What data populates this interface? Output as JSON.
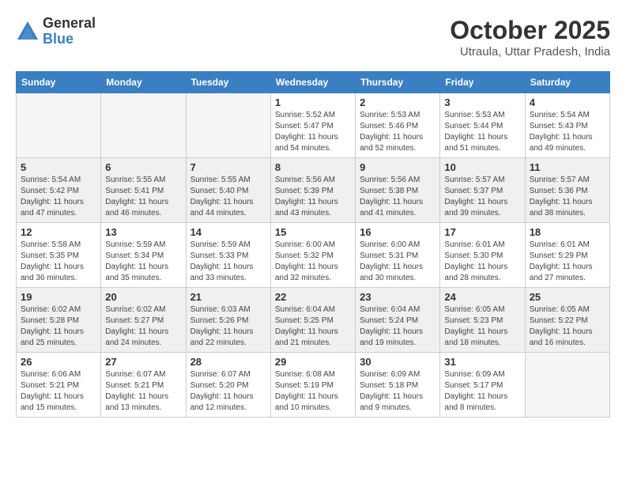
{
  "logo": {
    "general": "General",
    "blue": "Blue"
  },
  "title": {
    "month": "October 2025",
    "location": "Utraula, Uttar Pradesh, India"
  },
  "headers": [
    "Sunday",
    "Monday",
    "Tuesday",
    "Wednesday",
    "Thursday",
    "Friday",
    "Saturday"
  ],
  "weeks": [
    {
      "shaded": false,
      "days": [
        {
          "num": "",
          "sunrise": "",
          "sunset": "",
          "daylight": ""
        },
        {
          "num": "",
          "sunrise": "",
          "sunset": "",
          "daylight": ""
        },
        {
          "num": "",
          "sunrise": "",
          "sunset": "",
          "daylight": ""
        },
        {
          "num": "1",
          "sunrise": "Sunrise: 5:52 AM",
          "sunset": "Sunset: 5:47 PM",
          "daylight": "Daylight: 11 hours and 54 minutes."
        },
        {
          "num": "2",
          "sunrise": "Sunrise: 5:53 AM",
          "sunset": "Sunset: 5:46 PM",
          "daylight": "Daylight: 11 hours and 52 minutes."
        },
        {
          "num": "3",
          "sunrise": "Sunrise: 5:53 AM",
          "sunset": "Sunset: 5:44 PM",
          "daylight": "Daylight: 11 hours and 51 minutes."
        },
        {
          "num": "4",
          "sunrise": "Sunrise: 5:54 AM",
          "sunset": "Sunset: 5:43 PM",
          "daylight": "Daylight: 11 hours and 49 minutes."
        }
      ]
    },
    {
      "shaded": true,
      "days": [
        {
          "num": "5",
          "sunrise": "Sunrise: 5:54 AM",
          "sunset": "Sunset: 5:42 PM",
          "daylight": "Daylight: 11 hours and 47 minutes."
        },
        {
          "num": "6",
          "sunrise": "Sunrise: 5:55 AM",
          "sunset": "Sunset: 5:41 PM",
          "daylight": "Daylight: 11 hours and 46 minutes."
        },
        {
          "num": "7",
          "sunrise": "Sunrise: 5:55 AM",
          "sunset": "Sunset: 5:40 PM",
          "daylight": "Daylight: 11 hours and 44 minutes."
        },
        {
          "num": "8",
          "sunrise": "Sunrise: 5:56 AM",
          "sunset": "Sunset: 5:39 PM",
          "daylight": "Daylight: 11 hours and 43 minutes."
        },
        {
          "num": "9",
          "sunrise": "Sunrise: 5:56 AM",
          "sunset": "Sunset: 5:38 PM",
          "daylight": "Daylight: 11 hours and 41 minutes."
        },
        {
          "num": "10",
          "sunrise": "Sunrise: 5:57 AM",
          "sunset": "Sunset: 5:37 PM",
          "daylight": "Daylight: 11 hours and 39 minutes."
        },
        {
          "num": "11",
          "sunrise": "Sunrise: 5:57 AM",
          "sunset": "Sunset: 5:36 PM",
          "daylight": "Daylight: 11 hours and 38 minutes."
        }
      ]
    },
    {
      "shaded": false,
      "days": [
        {
          "num": "12",
          "sunrise": "Sunrise: 5:58 AM",
          "sunset": "Sunset: 5:35 PM",
          "daylight": "Daylight: 11 hours and 36 minutes."
        },
        {
          "num": "13",
          "sunrise": "Sunrise: 5:59 AM",
          "sunset": "Sunset: 5:34 PM",
          "daylight": "Daylight: 11 hours and 35 minutes."
        },
        {
          "num": "14",
          "sunrise": "Sunrise: 5:59 AM",
          "sunset": "Sunset: 5:33 PM",
          "daylight": "Daylight: 11 hours and 33 minutes."
        },
        {
          "num": "15",
          "sunrise": "Sunrise: 6:00 AM",
          "sunset": "Sunset: 5:32 PM",
          "daylight": "Daylight: 11 hours and 32 minutes."
        },
        {
          "num": "16",
          "sunrise": "Sunrise: 6:00 AM",
          "sunset": "Sunset: 5:31 PM",
          "daylight": "Daylight: 11 hours and 30 minutes."
        },
        {
          "num": "17",
          "sunrise": "Sunrise: 6:01 AM",
          "sunset": "Sunset: 5:30 PM",
          "daylight": "Daylight: 11 hours and 28 minutes."
        },
        {
          "num": "18",
          "sunrise": "Sunrise: 6:01 AM",
          "sunset": "Sunset: 5:29 PM",
          "daylight": "Daylight: 11 hours and 27 minutes."
        }
      ]
    },
    {
      "shaded": true,
      "days": [
        {
          "num": "19",
          "sunrise": "Sunrise: 6:02 AM",
          "sunset": "Sunset: 5:28 PM",
          "daylight": "Daylight: 11 hours and 25 minutes."
        },
        {
          "num": "20",
          "sunrise": "Sunrise: 6:02 AM",
          "sunset": "Sunset: 5:27 PM",
          "daylight": "Daylight: 11 hours and 24 minutes."
        },
        {
          "num": "21",
          "sunrise": "Sunrise: 6:03 AM",
          "sunset": "Sunset: 5:26 PM",
          "daylight": "Daylight: 11 hours and 22 minutes."
        },
        {
          "num": "22",
          "sunrise": "Sunrise: 6:04 AM",
          "sunset": "Sunset: 5:25 PM",
          "daylight": "Daylight: 11 hours and 21 minutes."
        },
        {
          "num": "23",
          "sunrise": "Sunrise: 6:04 AM",
          "sunset": "Sunset: 5:24 PM",
          "daylight": "Daylight: 11 hours and 19 minutes."
        },
        {
          "num": "24",
          "sunrise": "Sunrise: 6:05 AM",
          "sunset": "Sunset: 5:23 PM",
          "daylight": "Daylight: 11 hours and 18 minutes."
        },
        {
          "num": "25",
          "sunrise": "Sunrise: 6:05 AM",
          "sunset": "Sunset: 5:22 PM",
          "daylight": "Daylight: 11 hours and 16 minutes."
        }
      ]
    },
    {
      "shaded": false,
      "days": [
        {
          "num": "26",
          "sunrise": "Sunrise: 6:06 AM",
          "sunset": "Sunset: 5:21 PM",
          "daylight": "Daylight: 11 hours and 15 minutes."
        },
        {
          "num": "27",
          "sunrise": "Sunrise: 6:07 AM",
          "sunset": "Sunset: 5:21 PM",
          "daylight": "Daylight: 11 hours and 13 minutes."
        },
        {
          "num": "28",
          "sunrise": "Sunrise: 6:07 AM",
          "sunset": "Sunset: 5:20 PM",
          "daylight": "Daylight: 11 hours and 12 minutes."
        },
        {
          "num": "29",
          "sunrise": "Sunrise: 6:08 AM",
          "sunset": "Sunset: 5:19 PM",
          "daylight": "Daylight: 11 hours and 10 minutes."
        },
        {
          "num": "30",
          "sunrise": "Sunrise: 6:09 AM",
          "sunset": "Sunset: 5:18 PM",
          "daylight": "Daylight: 11 hours and 9 minutes."
        },
        {
          "num": "31",
          "sunrise": "Sunrise: 6:09 AM",
          "sunset": "Sunset: 5:17 PM",
          "daylight": "Daylight: 11 hours and 8 minutes."
        },
        {
          "num": "",
          "sunrise": "",
          "sunset": "",
          "daylight": ""
        }
      ]
    }
  ]
}
